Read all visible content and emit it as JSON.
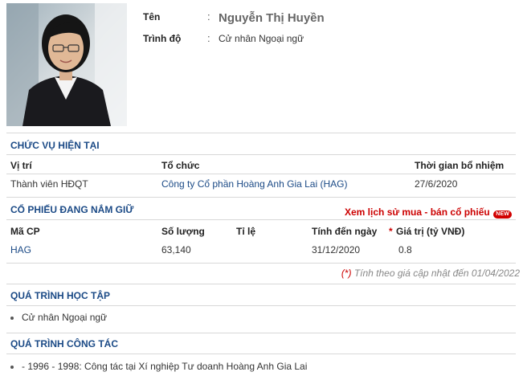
{
  "profile": {
    "name_label": "Tên",
    "name": "Nguyễn Thị Huyền",
    "degree_label": "Trình độ",
    "degree": "Cử nhân Ngoại ngữ",
    "colon": ":"
  },
  "positions": {
    "title": "CHỨC VỤ HIỆN TẠI",
    "headers": [
      "Vị trí",
      "Tổ chức",
      "Thời gian bổ nhiệm"
    ],
    "rows": [
      {
        "position": "Thành viên HĐQT",
        "organization": "Công ty Cổ phần Hoàng Anh Gia Lai (HAG)",
        "appointed": "27/6/2020"
      }
    ]
  },
  "holdings": {
    "title": "CỔ PHIẾU ĐANG NẮM GIỮ",
    "history_link": "Xem lịch sử mua - bán cổ phiếu",
    "new_badge": "NEW",
    "headers": [
      "Mã CP",
      "Số lượng",
      "Tỉ lệ",
      "Tính đến ngày",
      "*",
      "Giá trị (tỷ VNĐ)"
    ],
    "rows": [
      {
        "ticker": "HAG",
        "quantity": "63,140",
        "ratio": "",
        "as_of": "31/12/2020",
        "value": "0.8"
      }
    ],
    "note_star": "(*)",
    "note": " Tính theo giá cập nhật đến 01/04/2022"
  },
  "education": {
    "title": "QUÁ TRÌNH HỌC TẬP",
    "items": [
      "Cử nhân Ngoại ngữ"
    ]
  },
  "career": {
    "title": "QUÁ TRÌNH CÔNG TÁC",
    "items": [
      "- 1996 - 1998: Công tác tại Xí nghiệp Tư doanh Hoàng Anh Gia Lai"
    ]
  },
  "colors": {
    "section_title": "#1b4a86",
    "accent_red": "#cc0000",
    "divider": "#d8d8d8"
  }
}
